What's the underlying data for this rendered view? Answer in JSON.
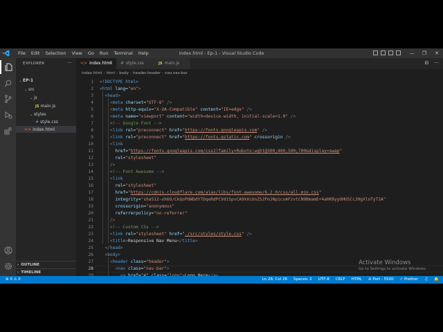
{
  "window": {
    "title": "index.html - Ep-1 - Visual Studio Code",
    "menu": [
      "File",
      "Edit",
      "Selection",
      "View",
      "Go",
      "Run",
      "Terminal",
      "Help"
    ]
  },
  "sidebar": {
    "title": "EXPLORER",
    "more": "···",
    "tree": [
      {
        "label": "EP-1",
        "type": "root"
      },
      {
        "label": "src",
        "type": "folder"
      },
      {
        "label": "js",
        "type": "folder"
      },
      {
        "label": "main.js",
        "type": "js",
        "badge": "JS"
      },
      {
        "label": "styles",
        "type": "folder"
      },
      {
        "label": "style.css",
        "type": "css",
        "badge": "#"
      },
      {
        "label": "index.html",
        "type": "html",
        "badge": "<>"
      }
    ],
    "outline": "OUTLINE",
    "timeline": "TIMELINE"
  },
  "tabs": [
    {
      "label": "index.html",
      "icon": "<>",
      "active": true,
      "close": "×"
    },
    {
      "label": "style.css",
      "icon": "#",
      "active": false
    },
    {
      "label": "main.js",
      "icon": "JS",
      "active": false
    }
  ],
  "tab_actions": [
    "⊟",
    "···"
  ],
  "breadcrumb": [
    "index.html",
    "html",
    "body",
    "header.header",
    "nav.nav-bar"
  ],
  "editor": {
    "current_line": 28,
    "lines": [
      [
        [
          "t-tag",
          "<!DOCTYPE html>"
        ]
      ],
      [
        [
          "t-br",
          "<"
        ],
        [
          "t-tag",
          "html "
        ],
        [
          "t-attr",
          "lang"
        ],
        [
          "t-txt",
          "="
        ],
        [
          "t-str",
          "\"en\""
        ],
        [
          "t-br",
          ">"
        ]
      ],
      [
        [
          "t-txt",
          "  "
        ],
        [
          "t-br",
          "<"
        ],
        [
          "t-tag",
          "head"
        ],
        [
          "t-br",
          ">"
        ]
      ],
      [
        [
          "t-txt",
          "    "
        ],
        [
          "t-br",
          "<"
        ],
        [
          "t-tag",
          "meta "
        ],
        [
          "t-attr",
          "charset"
        ],
        [
          "t-txt",
          "="
        ],
        [
          "t-str",
          "\"UTF-8\""
        ],
        [
          "t-br",
          " />"
        ]
      ],
      [
        [
          "t-txt",
          "    "
        ],
        [
          "t-br",
          "<"
        ],
        [
          "t-tag",
          "meta "
        ],
        [
          "t-attr",
          "http-equiv"
        ],
        [
          "t-txt",
          "="
        ],
        [
          "t-str",
          "\"X-UA-Compatible\""
        ],
        [
          "t-attr",
          " content"
        ],
        [
          "t-txt",
          "="
        ],
        [
          "t-str",
          "\"IE=edge\""
        ],
        [
          "t-br",
          " />"
        ]
      ],
      [
        [
          "t-txt",
          "    "
        ],
        [
          "t-br",
          "<"
        ],
        [
          "t-tag",
          "meta "
        ],
        [
          "t-attr",
          "name"
        ],
        [
          "t-txt",
          "="
        ],
        [
          "t-str",
          "\"viewport\""
        ],
        [
          "t-attr",
          " content"
        ],
        [
          "t-txt",
          "="
        ],
        [
          "t-str",
          "\"width=device-width, initial-scale=1.0\""
        ],
        [
          "t-br",
          " />"
        ]
      ],
      [
        [
          "t-txt",
          "    "
        ],
        [
          "t-com",
          "<!-- Google Font -->"
        ]
      ],
      [
        [
          "t-txt",
          "    "
        ],
        [
          "t-br",
          "<"
        ],
        [
          "t-tag",
          "link "
        ],
        [
          "t-attr",
          "rel"
        ],
        [
          "t-txt",
          "="
        ],
        [
          "t-str",
          "\"preconnect\""
        ],
        [
          "t-attr",
          " href"
        ],
        [
          "t-txt",
          "="
        ],
        [
          "t-str",
          "\""
        ],
        [
          "t-url",
          "https://fonts.googleapis.com"
        ],
        [
          "t-str",
          "\""
        ],
        [
          "t-br",
          " />"
        ]
      ],
      [
        [
          "t-txt",
          "    "
        ],
        [
          "t-br",
          "<"
        ],
        [
          "t-tag",
          "link "
        ],
        [
          "t-attr",
          "rel"
        ],
        [
          "t-txt",
          "="
        ],
        [
          "t-str",
          "\"preconnect\""
        ],
        [
          "t-attr",
          " href"
        ],
        [
          "t-txt",
          "="
        ],
        [
          "t-str",
          "\""
        ],
        [
          "t-url",
          "https://fonts.gstatic.com"
        ],
        [
          "t-str",
          "\""
        ],
        [
          "t-attr",
          " crossorigin"
        ],
        [
          "t-br",
          " />"
        ]
      ],
      [
        [
          "t-txt",
          "    "
        ],
        [
          "t-br",
          "<"
        ],
        [
          "t-tag",
          "link"
        ]
      ],
      [
        [
          "t-txt",
          "      "
        ],
        [
          "t-attr",
          "href"
        ],
        [
          "t-txt",
          "="
        ],
        [
          "t-str",
          "\""
        ],
        [
          "t-url",
          "https://fonts.googleapis.com/css2?family=Roboto:wght@300;400;500;700&display=swap"
        ],
        [
          "t-str",
          "\""
        ]
      ],
      [
        [
          "t-txt",
          "      "
        ],
        [
          "t-attr",
          "rel"
        ],
        [
          "t-txt",
          "="
        ],
        [
          "t-str",
          "\"stylesheet\""
        ]
      ],
      [
        [
          "t-txt",
          "    "
        ],
        [
          "t-br",
          "/>"
        ]
      ],
      [
        [
          "t-txt",
          "    "
        ],
        [
          "t-com",
          "<!-- Font Awesome -->"
        ]
      ],
      [
        [
          "t-txt",
          "    "
        ],
        [
          "t-br",
          "<"
        ],
        [
          "t-tag",
          "link"
        ]
      ],
      [
        [
          "t-txt",
          "      "
        ],
        [
          "t-attr",
          "rel"
        ],
        [
          "t-txt",
          "="
        ],
        [
          "t-str",
          "\"stylesheet\""
        ]
      ],
      [
        [
          "t-txt",
          "      "
        ],
        [
          "t-attr",
          "href"
        ],
        [
          "t-txt",
          "="
        ],
        [
          "t-str",
          "\""
        ],
        [
          "t-url",
          "https://cdnjs.cloudflare.com/ajax/libs/font-awesome/6.2.0/css/all.min.css"
        ],
        [
          "t-str",
          "\""
        ]
      ],
      [
        [
          "t-txt",
          "      "
        ],
        [
          "t-attr",
          "integrity"
        ],
        [
          "t-txt",
          "="
        ],
        [
          "t-str",
          "\"sha512-xh6O/CkQoPOWDdYTDqeRdPCVd1SpvCA9XXcUnZS2FmJNp1coAFzvtCN9BmamE+4aHK8yyUHUSCcJHgXloTyT2A\""
        ]
      ],
      [
        [
          "t-txt",
          "      "
        ],
        [
          "t-attr",
          "crossorigin"
        ],
        [
          "t-txt",
          "="
        ],
        [
          "t-str",
          "\"anonymous\""
        ]
      ],
      [
        [
          "t-txt",
          "      "
        ],
        [
          "t-attr",
          "referrerpolicy"
        ],
        [
          "t-txt",
          "="
        ],
        [
          "t-str",
          "\"no-referrer\""
        ]
      ],
      [
        [
          "t-txt",
          "    "
        ],
        [
          "t-br",
          "/>"
        ]
      ],
      [
        [
          "t-txt",
          "    "
        ],
        [
          "t-com",
          "<!-- Custom CSs -->"
        ]
      ],
      [
        [
          "t-txt",
          "    "
        ],
        [
          "t-br",
          "<"
        ],
        [
          "t-tag",
          "link "
        ],
        [
          "t-attr",
          "rel"
        ],
        [
          "t-txt",
          "="
        ],
        [
          "t-str",
          "\"stylesheet\""
        ],
        [
          "t-attr",
          " href"
        ],
        [
          "t-txt",
          "="
        ],
        [
          "t-str",
          "\""
        ],
        [
          "t-url",
          "./src/styles/style.css"
        ],
        [
          "t-str",
          "\""
        ],
        [
          "t-br",
          " />"
        ]
      ],
      [
        [
          "t-txt",
          "    "
        ],
        [
          "t-br",
          "<"
        ],
        [
          "t-tag",
          "title"
        ],
        [
          "t-br",
          ">"
        ],
        [
          "t-txt",
          "Responsive Nav Menu"
        ],
        [
          "t-br",
          "</"
        ],
        [
          "t-tag",
          "title"
        ],
        [
          "t-br",
          ">"
        ]
      ],
      [
        [
          "t-txt",
          "  "
        ],
        [
          "t-br",
          "</"
        ],
        [
          "t-tag",
          "head"
        ],
        [
          "t-br",
          ">"
        ]
      ],
      [
        [
          "t-txt",
          "  "
        ],
        [
          "t-br",
          "<"
        ],
        [
          "t-tag",
          "body"
        ],
        [
          "t-br",
          ">"
        ]
      ],
      [
        [
          "t-txt",
          "    "
        ],
        [
          "t-br",
          "<"
        ],
        [
          "t-tag",
          "header "
        ],
        [
          "t-attr",
          "class"
        ],
        [
          "t-txt",
          "="
        ],
        [
          "t-str",
          "\"header\""
        ],
        [
          "t-br",
          ">"
        ]
      ],
      [
        [
          "t-txt",
          "      "
        ],
        [
          "t-br",
          "<"
        ],
        [
          "t-tag",
          "nav "
        ],
        [
          "t-attr",
          "class"
        ],
        [
          "t-txt",
          "="
        ],
        [
          "t-str",
          "\"nav-bar\""
        ],
        [
          "t-br",
          ">"
        ]
      ],
      [
        [
          "t-txt",
          "        "
        ],
        [
          "t-br",
          "<"
        ],
        [
          "t-tag",
          "a "
        ],
        [
          "t-attr",
          "href"
        ],
        [
          "t-txt",
          "="
        ],
        [
          "t-str",
          "\"#\""
        ],
        [
          "t-attr",
          " class"
        ],
        [
          "t-txt",
          "="
        ],
        [
          "t-str",
          "\"logo\""
        ],
        [
          "t-br",
          ">"
        ],
        [
          "t-txt",
          "Logo Here"
        ],
        [
          "t-br",
          "</"
        ],
        [
          "t-tag",
          "a"
        ],
        [
          "t-br",
          ">"
        ]
      ]
    ]
  },
  "watermark": {
    "title": "Activate Windows",
    "subtitle": "Go to Settings to activate Windows."
  },
  "status": {
    "left": "⊗ 0  ⚠ 0",
    "right": [
      "Ln 28, Col 26",
      "Spaces: 2",
      "UTF-8",
      "CRLF",
      "HTML",
      "⊘ Port : 5500",
      "✓ Prettier",
      "♫",
      "🔔"
    ]
  },
  "colors": {
    "accent": "#007acc",
    "editor_bg": "#1e1e1e",
    "sidebar_bg": "#252526",
    "activity_bg": "#333333"
  }
}
